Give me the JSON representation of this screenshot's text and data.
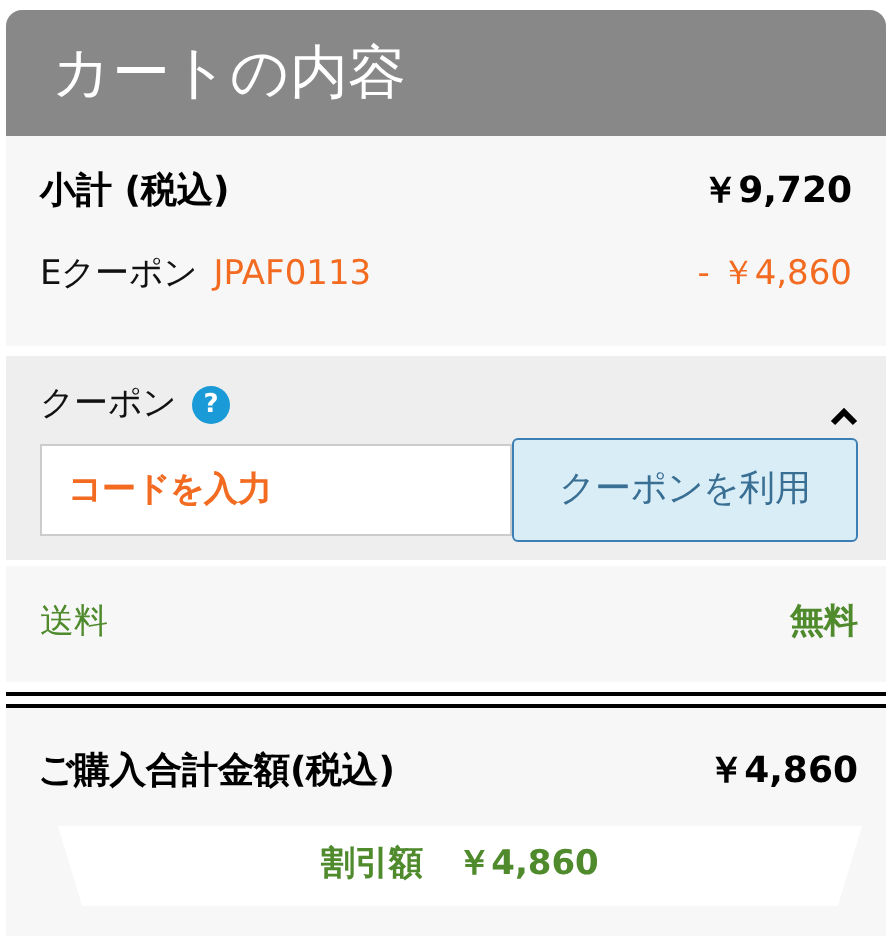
{
  "header": {
    "title": "カートの内容"
  },
  "subtotal": {
    "label": "小計 (税込)",
    "value": "￥9,720"
  },
  "coupon_applied": {
    "label": "Eクーポン",
    "code": "JPAF0113",
    "value": "- ￥4,860"
  },
  "coupon": {
    "label": "クーポン",
    "help": "?",
    "expanded": true,
    "field": {
      "placeholder": "コードを入力"
    },
    "button": "クーポンを利用"
  },
  "shipping": {
    "label": "送料",
    "value": "無料"
  },
  "total": {
    "label": "ご購入合計金額(税込)",
    "value": "￥4,860"
  },
  "discount": {
    "label": "割引額",
    "value": "￥4,860"
  }
}
